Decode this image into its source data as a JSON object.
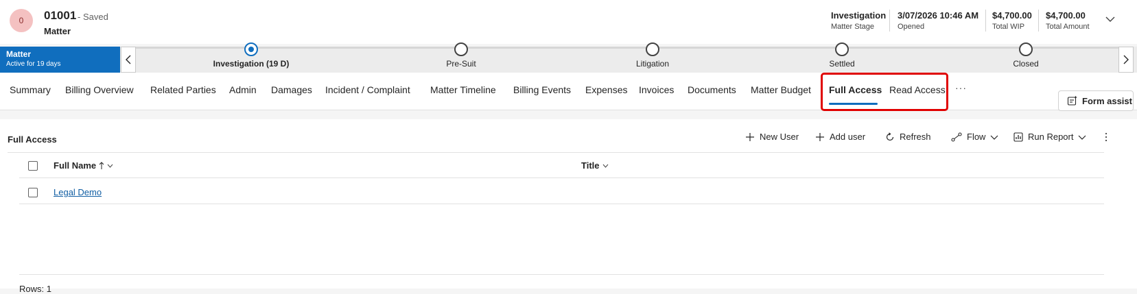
{
  "header": {
    "avatar_initial": "0",
    "record_number": "01001",
    "save_status": "- Saved",
    "entity_name": "Matter",
    "fields": [
      {
        "value": "Investigation",
        "label": "Matter Stage"
      },
      {
        "value": "3/07/2026 10:46 AM",
        "label": "Opened"
      },
      {
        "value": "$4,700.00",
        "label": "Total WIP"
      },
      {
        "value": "$4,700.00",
        "label": "Total Amount"
      }
    ],
    "expand_icon": "chevron-down-icon"
  },
  "bpf": {
    "process_name": "Matter",
    "process_status": "Active for 19 days",
    "stages": [
      {
        "label": "Investigation  (19 D)",
        "active": true
      },
      {
        "label": "Pre-Suit",
        "active": false
      },
      {
        "label": "Litigation",
        "active": false
      },
      {
        "label": "Settled",
        "active": false
      },
      {
        "label": "Closed",
        "active": false
      }
    ]
  },
  "tabs": {
    "items": [
      "Summary",
      "Billing Overview",
      "Related Parties",
      "Admin",
      "Damages",
      "Incident / Complaint",
      "Matter Timeline",
      "Billing Events",
      "Expenses",
      "Invoices",
      "Documents",
      "Matter Budget",
      "Full Access",
      "Read Access"
    ],
    "selected": "Full Access",
    "more_label": "···",
    "form_assist_label": "Form assist"
  },
  "subgrid": {
    "title": "Full Access",
    "commands": {
      "new_user": "New User",
      "add_user": "Add user",
      "refresh": "Refresh",
      "flow": "Flow",
      "run_report": "Run Report"
    },
    "columns": {
      "full_name": "Full Name",
      "title": "Title"
    },
    "rows": [
      {
        "full_name": "Legal Demo",
        "title": ""
      }
    ],
    "footer": "Rows: 1"
  },
  "colors": {
    "brand_blue": "#106ebe",
    "highlight_red": "#e00000",
    "link_blue": "#115ea3"
  }
}
